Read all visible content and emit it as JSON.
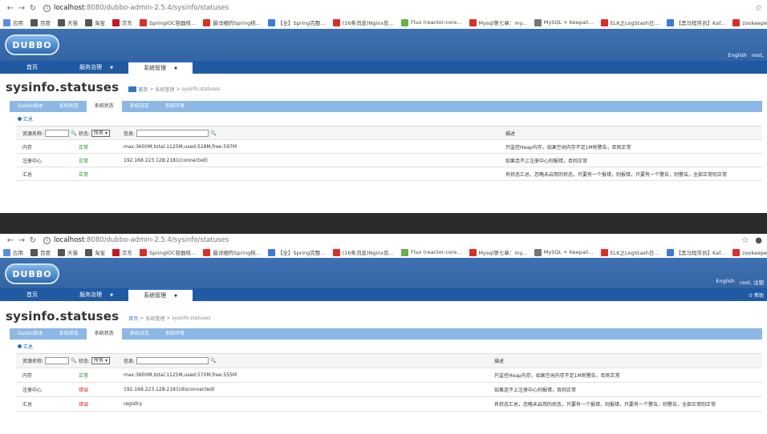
{
  "browser": {
    "url_host": "localhost",
    "url_rest": ":8080/dubbo-admin-2.5.4/sysinfo/statuses",
    "bookmarks": [
      {
        "label": "应用",
        "color": "#5a8de0"
      },
      {
        "label": "百度",
        "color": "#555555"
      },
      {
        "label": "天猫",
        "color": "#555555"
      },
      {
        "label": "淘宝",
        "color": "#555555"
      },
      {
        "label": "京东",
        "color": "#c81623"
      },
      {
        "label": "SpringIOC容器核...",
        "color": "#d93025"
      },
      {
        "label": "最详细的Spring核...",
        "color": "#d93025"
      },
      {
        "label": "【全】Spring完整...",
        "color": "#3b7ad8"
      },
      {
        "label": "(16条消息)Nginx反...",
        "color": "#d93025"
      },
      {
        "label": "Flux (reactor-core...",
        "color": "#6ab04c"
      },
      {
        "label": "Mysql第七章：my...",
        "color": "#d93025"
      },
      {
        "label": "MySQL + Keepali...",
        "color": "#777777"
      },
      {
        "label": "ELK之LogStash日...",
        "color": "#d93025"
      },
      {
        "label": "【黑马程序员】Kaf...",
        "color": "#3b7ad8"
      },
      {
        "label": "zookeeper集群..",
        "color": "#d93025"
      }
    ]
  },
  "app": {
    "logo": "DUBBO",
    "header_links": [
      "English",
      "root,"
    ],
    "header_links_2": [
      "English",
      "root, 注销"
    ],
    "menus": [
      "首页",
      "服务治理",
      "系统管理"
    ],
    "help": "帮助",
    "page_title": "sysinfo.statuses",
    "breadcrumb": [
      "首页",
      "系统管理",
      "sysinfo.statuses"
    ],
    "tabs": [
      "Dubbo版本",
      "系统状态",
      "系统状态",
      "系统日志",
      "系统环境"
    ],
    "summary": "汇总",
    "filter": {
      "resource_label": "资源名称:",
      "status_label": "状态:",
      "status_value": "所有",
      "info_label": "信息:",
      "desc_label": "描述"
    }
  },
  "shot1": {
    "rows": [
      {
        "name": "内存",
        "status": "正常",
        "status_type": "ok",
        "info": "max:3600M,total:1125M,used:528M,free:597M",
        "desc": "只监控Heap内存，如果空闲内存不足1M则警告，否则正常"
      },
      {
        "name": "注册中心",
        "status": "正常",
        "status_type": "ok",
        "info": "192.168.223.128:2181(connected)",
        "desc": "如果连不上注册中心则报错，否则正常"
      },
      {
        "name": "汇总",
        "status": "正常",
        "status_type": "ok",
        "info": "",
        "desc": "有状态汇总，忽略未启用的状态，只要有一个报错，则报错，只要有一个警告，则警告，全部正常则正常"
      }
    ]
  },
  "shot2": {
    "rows": [
      {
        "name": "内存",
        "status": "正常",
        "status_type": "ok",
        "info": "max:3600M,total:1125M,used:570M,free:555M",
        "desc": "只监控Heap内存，如果空闲内存不足1M则警告，否则正常"
      },
      {
        "name": "注册中心",
        "status": "错误",
        "status_type": "err",
        "info": "192.168.223.128:2181(disconnected)",
        "desc": "如果连不上注册中心则报错，否则正常"
      },
      {
        "name": "汇总",
        "status": "错误",
        "status_type": "err",
        "info": "registry",
        "desc": "有状态汇总，忽略未启用的状态，只要有一个报错，则报错，只要有一个警告，则警告，全部正常则正常"
      }
    ]
  }
}
